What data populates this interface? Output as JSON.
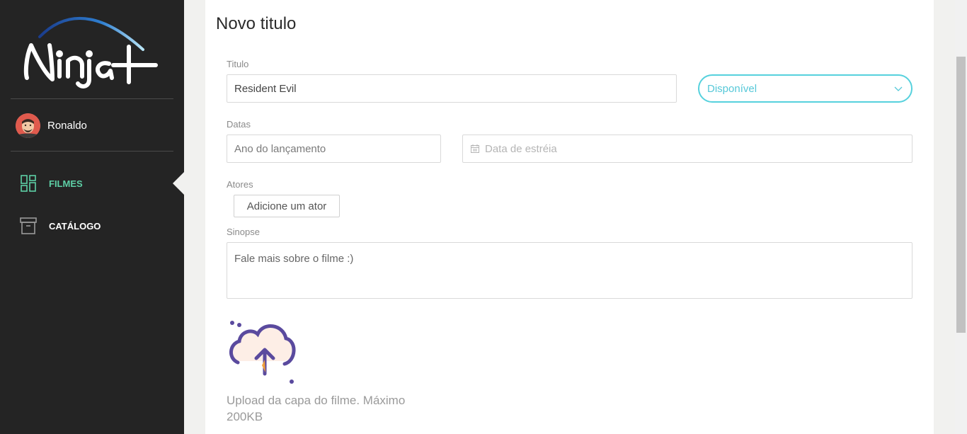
{
  "brand": {
    "logo_text": "Ninja+"
  },
  "user": {
    "name": "Ronaldo"
  },
  "nav": {
    "items": [
      {
        "label": "FILMES",
        "icon": "dashboard-icon",
        "active": true
      },
      {
        "label": "CATÁLOGO",
        "icon": "archive-icon",
        "active": false
      }
    ]
  },
  "page": {
    "title": "Novo titulo"
  },
  "form": {
    "title_label": "Titulo",
    "title_value": "Resident Evil",
    "status_value": "Disponível",
    "dates_label": "Datas",
    "release_year_placeholder": "Ano do lançamento",
    "premiere_date_placeholder": "Data de estréia",
    "actors_label": "Atores",
    "add_actor_label": "Adicione um ator",
    "synopsis_label": "Sinopse",
    "synopsis_placeholder": "Fale mais sobre o filme :)",
    "upload_text": "Upload da capa do filme. Máximo 200KB"
  },
  "colors": {
    "sidebar_bg": "#242424",
    "accent_green": "#5ed0a6",
    "accent_cyan": "#56d1dd",
    "upload_purple": "#5a4a9e"
  }
}
